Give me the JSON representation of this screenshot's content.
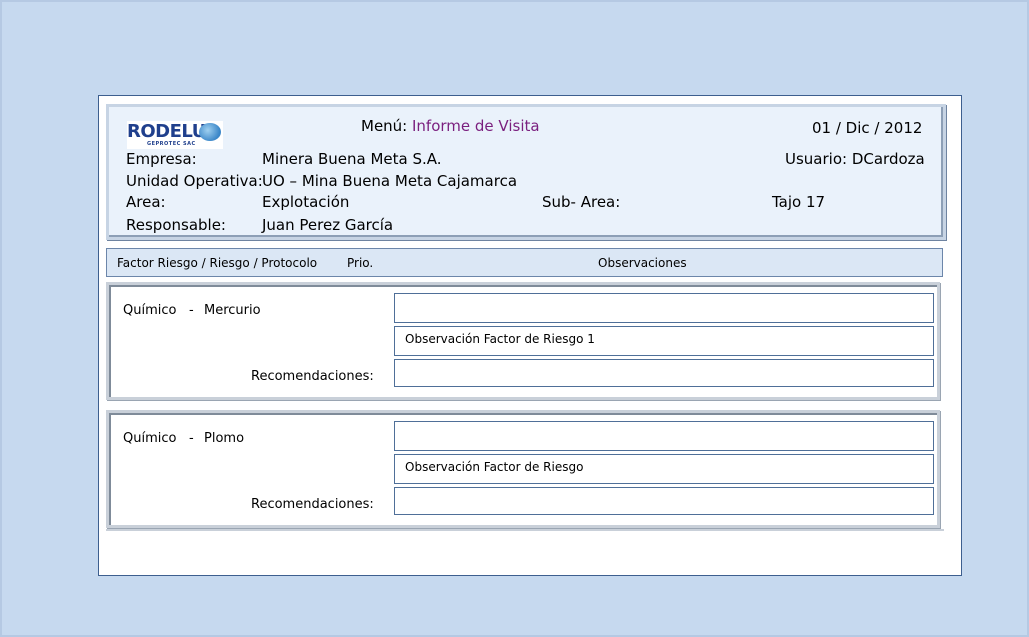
{
  "header": {
    "logo_text": "RODELU",
    "logo_sub": "GEPROTEC SAC",
    "menu_label": "Menú:",
    "menu_value": "Informe de Visita",
    "date": "01 / Dic / 2012",
    "empresa_label": "Empresa:",
    "empresa_value": "Minera Buena Meta S.A.",
    "usuario": "Usuario: DCardoza",
    "unidad_label": "Unidad Operativa:",
    "unidad_value": "UO – Mina Buena Meta  Cajamarca",
    "area_label": "Area:",
    "area_value": "Explotación",
    "subarea_label": "Sub- Area:",
    "subarea_value": "Tajo 17",
    "responsable_label": "Responsable:",
    "responsable_value": "Juan Perez García"
  },
  "columns": {
    "factor": "Factor Riesgo / Riesgo / Protocolo",
    "prio": "Prio.",
    "observaciones": "Observaciones"
  },
  "risks": [
    {
      "factor": "Químico",
      "sep": "-",
      "riesgo": "Mercurio",
      "field1": "",
      "observacion": "Observación Factor de Riesgo 1",
      "rec_label": "Recomendaciones:",
      "recomendacion": ""
    },
    {
      "factor": "Químico",
      "sep": "-",
      "riesgo": "Plomo",
      "field1": "",
      "observacion": "Observación Factor de Riesgo",
      "rec_label": "Recomendaciones:",
      "recomendacion": ""
    }
  ],
  "colors": {
    "background": "#c6d9ef",
    "header_bg": "#eaf2fb",
    "menu_value": "#7a1f7e",
    "logo": "#1f3f8c"
  }
}
